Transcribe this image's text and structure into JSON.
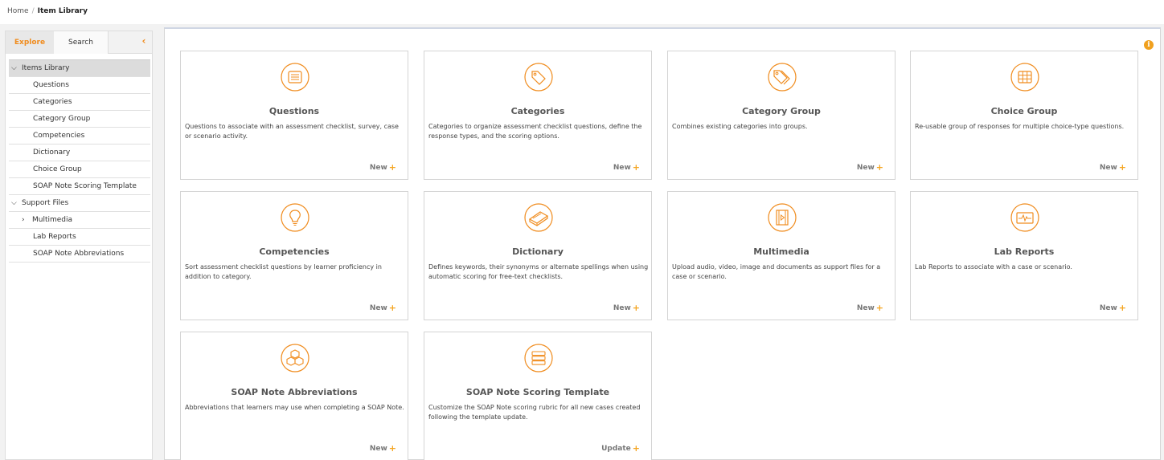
{
  "breadcrumb": {
    "home": "Home",
    "separator": "/",
    "current": "Item Library"
  },
  "sidebar": {
    "tabs": {
      "explore": "Explore",
      "search": "Search"
    },
    "collapse_glyph": "‹",
    "items_library": "Items Library",
    "library_items": [
      "Questions",
      "Categories",
      "Category Group",
      "Competencies",
      "Dictionary",
      "Choice Group",
      "SOAP Note Scoring Template"
    ],
    "support_files": "Support Files",
    "multimedia": "Multimedia",
    "support_items": [
      "Lab Reports",
      "SOAP Note Abbreviations"
    ]
  },
  "main": {
    "info_glyph": "i"
  },
  "accent_color": "#f08c1e",
  "cards": [
    {
      "title": "Questions",
      "icon": "questions-list-icon",
      "description": "Questions to associate with an assessment checklist, survey, case or scenario activity.",
      "action": "New"
    },
    {
      "title": "Categories",
      "icon": "tag-icon",
      "description": "Categories to organize assessment checklist questions, define the response types, and the scoring options.",
      "action": "New"
    },
    {
      "title": "Category Group",
      "icon": "tags-icon",
      "description": "Combines existing categories into groups.",
      "action": "New"
    },
    {
      "title": "Choice Group",
      "icon": "grid-icon",
      "description": "Re-usable group of responses for multiple choice-type questions.",
      "action": "New"
    },
    {
      "title": "Competencies",
      "icon": "lightbulb-icon",
      "description": "Sort assessment checklist questions by learner proficiency in addition to category.",
      "action": "New"
    },
    {
      "title": "Dictionary",
      "icon": "book-icon",
      "description": "Defines keywords, their synonyms or alternate spellings when using automatic scoring for free-text checklists.",
      "action": "New"
    },
    {
      "title": "Multimedia",
      "icon": "film-icon",
      "description": "Upload audio, video, image and documents as support files for a case or scenario.",
      "action": "New"
    },
    {
      "title": "Lab Reports",
      "icon": "pulse-monitor-icon",
      "description": "Lab Reports to associate with a case or scenario.",
      "action": "New"
    },
    {
      "title": "SOAP Note Abbreviations",
      "icon": "cubes-icon",
      "description": "Abbreviations that learners may use when completing a SOAP Note.",
      "action": "New"
    },
    {
      "title": "SOAP Note Scoring Template",
      "icon": "stack-list-icon",
      "description": "Customize the SOAP Note scoring rubric for all new cases created following the template update.",
      "action": "Update"
    }
  ]
}
